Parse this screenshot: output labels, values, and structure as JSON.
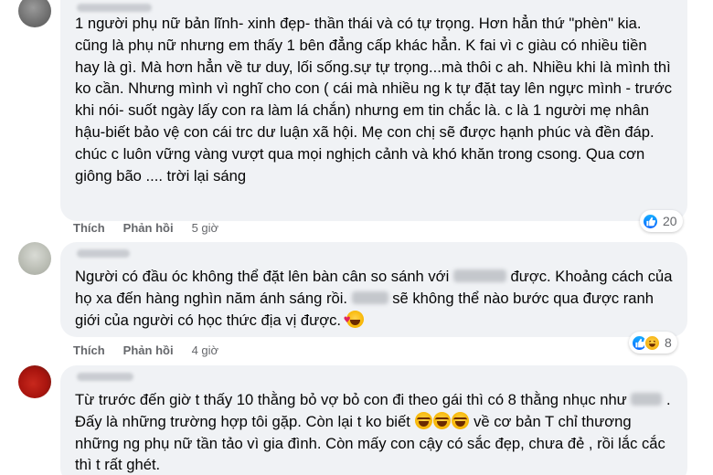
{
  "comments": [
    {
      "text_before": "1 người phụ nữ bản lĩnh- xinh đẹp- thần thái và có tự trọng. Hơn hẳn thứ \"phèn\" kia. cũng là phụ nữ nhưng em thấy 1 bên đẳng cấp khác hẳn. K fai vì c giàu có nhiều tiền hay là gì. Mà hơn hẳn về tư duy, lối sống.sự tự trọng...mà thôi c ah. Nhiều khi là mình thì ko cần. Nhưng mình vì nghĩ cho con ( cái mà nhiều ng k tự đặt tay lên ngực mình - trước khi nói- suốt ngày lấy con ra làm lá chắn) nhưng em tin chắc là. c là 1 người mẹ nhân hậu-biết bảo vệ con cái trc dư luận xã hội. Mẹ con chị sẽ được hạnh phúc và đền đáp.",
      "text_after": "chúc c luôn vững vàng vượt qua mọi nghịch cảnh và khó khăn trong csong. Qua cơn giông bão .... trời lại sáng",
      "like_label": "Thích",
      "reply_label": "Phản hồi",
      "time": "5 giờ",
      "reaction_count": "20"
    },
    {
      "text_1": "Người có đầu óc không thể đặt lên bàn cân so sánh với",
      "text_2": "được. Khoảng cách của họ xa đến hàng nghìn năm ánh sáng rồi.",
      "text_3": "sẽ không thể nào bước qua được ranh giới của người có học thức địa vị được.",
      "like_label": "Thích",
      "reply_label": "Phản hồi",
      "time": "4 giờ",
      "reaction_count": "8"
    },
    {
      "text_1": "Từ trước đến giờ t thấy 10 thằng bỏ vợ bỏ con đi theo gái thì có 8 thằng nhục như",
      "text_2": ". Đấy là những trường hợp tôi gặp. Còn lại t ko biết",
      "text_3": "về cơ bản T chỉ thương những ng phụ nữ tần tảo vì gia đình. Còn mấy con cậy có sắc đẹp, chưa đẻ , rồi lắc cắc thì t rất ghét."
    }
  ],
  "colors": {
    "bubble": "#f0f2f5",
    "action_text": "#65676b",
    "like_blue": "#0866ff"
  }
}
